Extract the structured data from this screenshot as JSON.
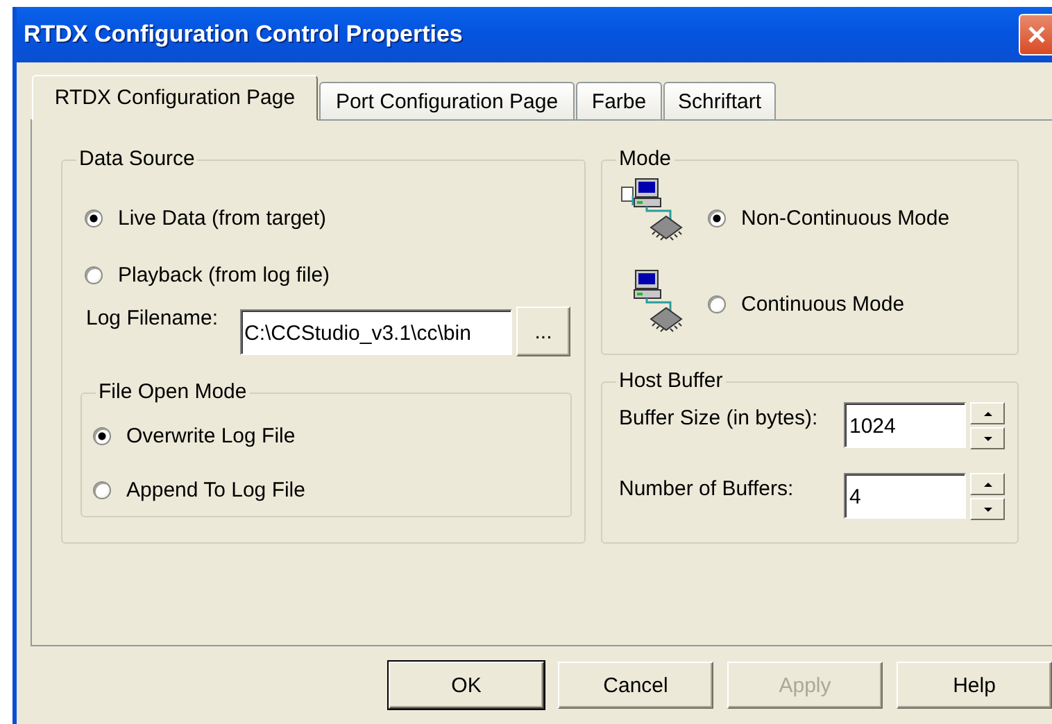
{
  "window": {
    "title": "RTDX Configuration Control Properties"
  },
  "tabs": [
    {
      "label": "RTDX Configuration Page",
      "selected": true
    },
    {
      "label": "Port Configuration Page",
      "selected": false
    },
    {
      "label": "Farbe",
      "selected": false
    },
    {
      "label": "Schriftart",
      "selected": false
    }
  ],
  "data_source": {
    "title": "Data Source",
    "options": [
      {
        "label": "Live Data (from target)",
        "selected": true
      },
      {
        "label": "Playback (from log file)",
        "selected": false
      }
    ],
    "log_filename": {
      "label": "Log Filename:",
      "value": "C:\\CCStudio_v3.1\\cc\\bin",
      "browse_button": "..."
    },
    "file_open_mode": {
      "title": "File Open Mode",
      "options": [
        {
          "label": "Overwrite Log File",
          "selected": true
        },
        {
          "label": "Append To Log File",
          "selected": false
        }
      ]
    }
  },
  "mode": {
    "title": "Mode",
    "options": [
      {
        "label": "Non-Continuous Mode",
        "selected": true
      },
      {
        "label": "Continuous Mode",
        "selected": false
      }
    ]
  },
  "host_buffer": {
    "title": "Host Buffer",
    "fields": [
      {
        "label": "Buffer Size (in bytes):",
        "value": "1024"
      },
      {
        "label": "Number of Buffers:",
        "value": "4"
      }
    ]
  },
  "buttons": [
    {
      "label": "OK",
      "default": true,
      "disabled": false
    },
    {
      "label": "Cancel",
      "default": false,
      "disabled": false
    },
    {
      "label": "Apply",
      "default": false,
      "disabled": true
    },
    {
      "label": "Help",
      "default": false,
      "disabled": false
    }
  ]
}
